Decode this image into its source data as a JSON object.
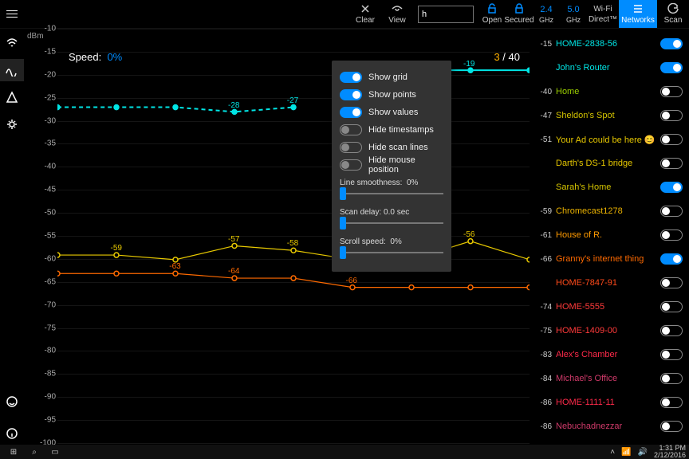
{
  "topbar": {
    "clear": "Clear",
    "view": "View",
    "search_value": "h",
    "open": "Open",
    "secured": "Secured",
    "ghz24": "2.4",
    "ghz24_sub": "GHz",
    "ghz50": "5.0",
    "ghz50_sub": "GHz",
    "wifi": "Wi-Fi",
    "wifi_sub": "Direct™",
    "networks": "Networks",
    "scan": "Scan"
  },
  "chart": {
    "axis_label": "dBm",
    "speed_label": "Speed:",
    "speed_value": "0%",
    "counter_cur": "3",
    "counter_sep": " / ",
    "counter_total": "40"
  },
  "popup": {
    "show_grid": "Show grid",
    "show_points": "Show points",
    "show_values": "Show values",
    "hide_timestamps": "Hide timestamps",
    "hide_scanlines": "Hide scan lines",
    "hide_mouse": "Hide mouse position",
    "smooth_label": "Line smoothness:",
    "smooth_val": "0%",
    "delay_label": "Scan delay: 0.0 sec",
    "scroll_label": "Scroll speed:",
    "scroll_val": "0%"
  },
  "networks": [
    {
      "rssi": "-15",
      "name": "HOME-2838-56",
      "color": "#00e5e5",
      "on": true
    },
    {
      "rssi": "",
      "name": "John's Router",
      "color": "#00e5e5",
      "on": true
    },
    {
      "rssi": "-40",
      "name": "Home",
      "color": "#99cc00",
      "on": false
    },
    {
      "rssi": "-47",
      "name": "Sheldon's Spot",
      "color": "#d4c400",
      "on": false
    },
    {
      "rssi": "-51",
      "name": "Your Ad could be here 😊",
      "color": "#e8c900",
      "on": false
    },
    {
      "rssi": "",
      "name": "Darth's DS-1 bridge",
      "color": "#e8c900",
      "on": false
    },
    {
      "rssi": "",
      "name": "Sarah's Home",
      "color": "#d4c400",
      "on": true
    },
    {
      "rssi": "-59",
      "name": "Chromecast1278",
      "color": "#e8b000",
      "on": false
    },
    {
      "rssi": "-61",
      "name": "House of R.",
      "color": "#ff9a00",
      "on": false
    },
    {
      "rssi": "-66",
      "name": "Granny's internet thing",
      "color": "#ff6a00",
      "on": true
    },
    {
      "rssi": "",
      "name": "HOME-7847-91",
      "color": "#ff4a1a",
      "on": false
    },
    {
      "rssi": "-74",
      "name": "HOME-5555",
      "color": "#ff3a3a",
      "on": false
    },
    {
      "rssi": "-75",
      "name": "HOME-1409-00",
      "color": "#ff3a3a",
      "on": false
    },
    {
      "rssi": "-83",
      "name": "Alex's Chamber",
      "color": "#ff2a4a",
      "on": false
    },
    {
      "rssi": "-84",
      "name": "Michael's Office",
      "color": "#d03a6a",
      "on": false
    },
    {
      "rssi": "-86",
      "name": "HOME-1111-11",
      "color": "#ff2a4a",
      "on": false
    },
    {
      "rssi": "-86",
      "name": "Nebuchadnezzar",
      "color": "#d03a6a",
      "on": false
    }
  ],
  "taskbar": {
    "time": "1:31 PM",
    "date": "2/12/2016"
  },
  "chart_data": {
    "type": "line",
    "ylabel": "dBm",
    "ylim": [
      -100,
      -10
    ],
    "y_ticks": [
      -10,
      -15,
      -20,
      -25,
      -30,
      -35,
      -40,
      -45,
      -50,
      -55,
      -60,
      -65,
      -70,
      -75,
      -80,
      -85,
      -90,
      -95,
      -100
    ],
    "x": [
      0,
      1,
      2,
      3,
      4,
      5,
      6,
      7,
      8
    ],
    "series": [
      {
        "name": "cyan-upper",
        "color": "#00e5e5",
        "style": "solid",
        "labels": [
          null,
          null,
          null,
          null,
          null,
          null,
          "-19",
          "-19",
          null
        ],
        "values": [
          null,
          null,
          null,
          null,
          null,
          -19,
          -19,
          -19,
          -19
        ]
      },
      {
        "name": "cyan-lower",
        "color": "#00e5e5",
        "style": "dashed",
        "labels": [
          null,
          null,
          null,
          "-28",
          "-27",
          null,
          null,
          null,
          null
        ],
        "values": [
          -27,
          -27,
          -27,
          -28,
          -27,
          null,
          null,
          null,
          null
        ]
      },
      {
        "name": "yellow",
        "color": "#e8c900",
        "style": "solid",
        "labels": [
          null,
          "-59",
          null,
          "-57",
          "-58",
          null,
          null,
          "-56",
          null
        ],
        "values": [
          -59,
          -59,
          -60,
          -57,
          -58,
          -60,
          -60,
          -56,
          -60
        ]
      },
      {
        "name": "orange",
        "color": "#ff6a00",
        "style": "solid",
        "labels": [
          null,
          null,
          "-63",
          "-64",
          null,
          "-66",
          null,
          null,
          null
        ],
        "values": [
          -63,
          -63,
          -63,
          -64,
          -64,
          -66,
          -66,
          -66,
          -66
        ]
      }
    ]
  }
}
